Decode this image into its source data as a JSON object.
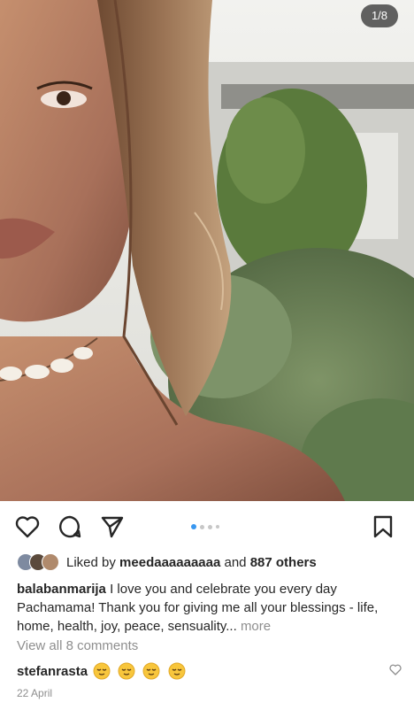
{
  "photo": {
    "counter": "1/8"
  },
  "actions": {
    "like_icon": "heart-icon",
    "comment_icon": "comment-icon",
    "share_icon": "send-icon",
    "save_icon": "bookmark-icon"
  },
  "carousel": {
    "active_index": 1,
    "dot_count": 4,
    "accent": "#3897f0"
  },
  "likes": {
    "prefix": "Liked by",
    "user": "meedaaaaaaaaa",
    "middle": "and",
    "others": "887 others"
  },
  "caption": {
    "user": "balabanmarija",
    "text": "I love you and celebrate you every day Pachamama! Thank you for giving me all your blessings - life, home, health, joy, peace, sensuality...",
    "more": "more"
  },
  "comments": {
    "view_all": "View all 8 comments",
    "items": [
      {
        "user": "stefanrasta",
        "emoji_count": 4
      }
    ]
  },
  "date": "22 April",
  "colors": {
    "text": "#262626",
    "muted": "#8e8e8e",
    "dot_inactive": "#c7c7c7"
  }
}
